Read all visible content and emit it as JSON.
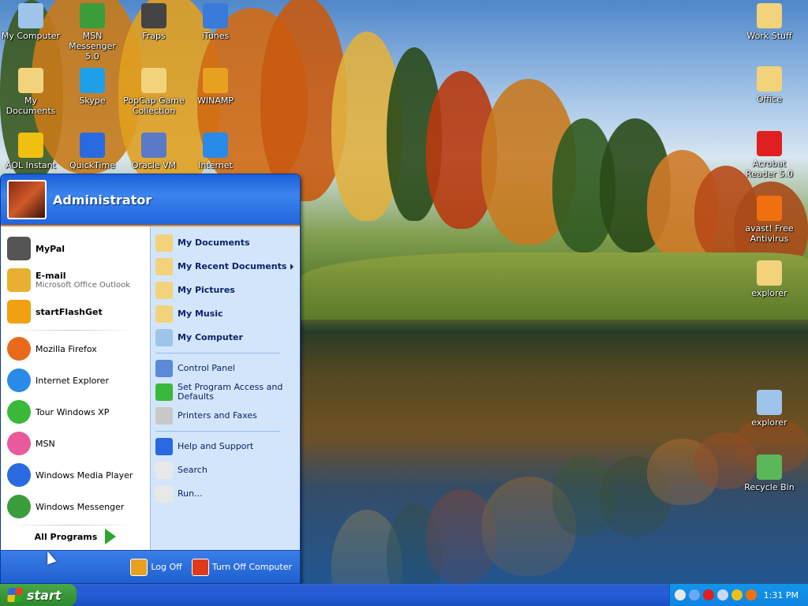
{
  "desktop": {
    "icons_left": [
      {
        "label": "My Computer",
        "icon": "computer-icon",
        "color": "#9ec4ec"
      },
      {
        "label": "MSN Messenger 5.0",
        "icon": "msn-messenger-icon",
        "color": "#3a9c3a"
      },
      {
        "label": "Fraps",
        "icon": "fraps-icon",
        "color": "#444444"
      },
      {
        "label": "iTunes",
        "icon": "itunes-icon",
        "color": "#3a7ad8"
      },
      {
        "label": "My Documents",
        "icon": "documents-folder-icon",
        "color": "#f2d27a"
      },
      {
        "label": "Skype",
        "icon": "skype-icon",
        "color": "#1ea0e8"
      },
      {
        "label": "PopCap Game Collection",
        "icon": "folder-icon",
        "color": "#f2d27a"
      },
      {
        "label": "WINAMP",
        "icon": "winamp-icon",
        "color": "#e8a020"
      },
      {
        "label": "AOL Instant",
        "icon": "aim-icon",
        "color": "#f0c010"
      },
      {
        "label": "QuickTime",
        "icon": "quicktime-icon",
        "color": "#2a6ae0"
      },
      {
        "label": "Oracle VM",
        "icon": "virtualbox-icon",
        "color": "#5a7ac8"
      },
      {
        "label": "Internet",
        "icon": "internet-explorer-icon",
        "color": "#2a8ae8"
      }
    ],
    "icons_right": [
      {
        "label": "Work Stuff",
        "icon": "folder-icon",
        "color": "#f2d27a"
      },
      {
        "label": "Office",
        "icon": "office-folder-icon",
        "color": "#f2d27a"
      },
      {
        "label": "Acrobat Reader 5.0",
        "icon": "acrobat-icon",
        "color": "#e02020"
      },
      {
        "label": "avast! Free Antivirus",
        "icon": "avast-icon",
        "color": "#f07010"
      },
      {
        "label": "explorer",
        "icon": "explorer-folder-icon",
        "color": "#f2d27a"
      },
      {
        "label": "explorer",
        "icon": "explorer-computer-icon",
        "color": "#9ec4ec"
      },
      {
        "label": "Recycle Bin",
        "icon": "recycle-bin-icon",
        "color": "#5ab85a"
      }
    ]
  },
  "start_menu": {
    "user_name": "Administrator",
    "pinned": [
      {
        "title": "MyPal",
        "subtitle": "",
        "icon": "mypal-icon",
        "color": "#555555"
      },
      {
        "title": "E-mail",
        "subtitle": "Microsoft Office Outlook",
        "icon": "outlook-icon",
        "color": "#e8b030"
      },
      {
        "title": "startFlashGet",
        "subtitle": "",
        "icon": "flashget-icon",
        "color": "#f0a010"
      }
    ],
    "recent": [
      {
        "label": "Mozilla Firefox",
        "icon": "firefox-icon",
        "color": "#e86a1a"
      },
      {
        "label": "Internet Explorer",
        "icon": "internet-explorer-icon",
        "color": "#2a8ae8"
      },
      {
        "label": "Tour Windows XP",
        "icon": "tour-xp-icon",
        "color": "#3ab83a"
      },
      {
        "label": "MSN",
        "icon": "msn-icon",
        "color": "#e85a9a"
      },
      {
        "label": "Windows Media Player",
        "icon": "media-player-icon",
        "color": "#2a6ae0"
      },
      {
        "label": "Windows Messenger",
        "icon": "messenger-icon",
        "color": "#3a9c3a"
      }
    ],
    "all_programs": "All Programs",
    "places": [
      {
        "label": "My Documents",
        "icon": "documents-folder-icon",
        "color": "#f2d27a",
        "bold": true
      },
      {
        "label": "My Recent Documents",
        "icon": "recent-documents-icon",
        "color": "#f2d27a",
        "bold": true,
        "submenu": true
      },
      {
        "label": "My Pictures",
        "icon": "pictures-folder-icon",
        "color": "#f2d27a",
        "bold": true
      },
      {
        "label": "My Music",
        "icon": "music-folder-icon",
        "color": "#f2d27a",
        "bold": true
      },
      {
        "label": "My Computer",
        "icon": "computer-icon",
        "color": "#9ec4ec",
        "bold": true
      }
    ],
    "system": [
      {
        "label": "Control Panel",
        "icon": "control-panel-icon",
        "color": "#5a8ad8"
      },
      {
        "label": "Set Program Access and Defaults",
        "icon": "program-defaults-icon",
        "color": "#3ab83a"
      },
      {
        "label": "Printers and Faxes",
        "icon": "printer-icon",
        "color": "#c8c8c8"
      }
    ],
    "help": [
      {
        "label": "Help and Support",
        "icon": "help-icon",
        "color": "#2a6ae0"
      },
      {
        "label": "Search",
        "icon": "search-icon",
        "color": "#e8e8e8"
      },
      {
        "label": "Run...",
        "icon": "run-icon",
        "color": "#e8e8e8"
      }
    ],
    "log_off": "Log Off",
    "turn_off": "Turn Off Computer"
  },
  "taskbar": {
    "start_label": "start",
    "clock": "1:31 PM"
  }
}
